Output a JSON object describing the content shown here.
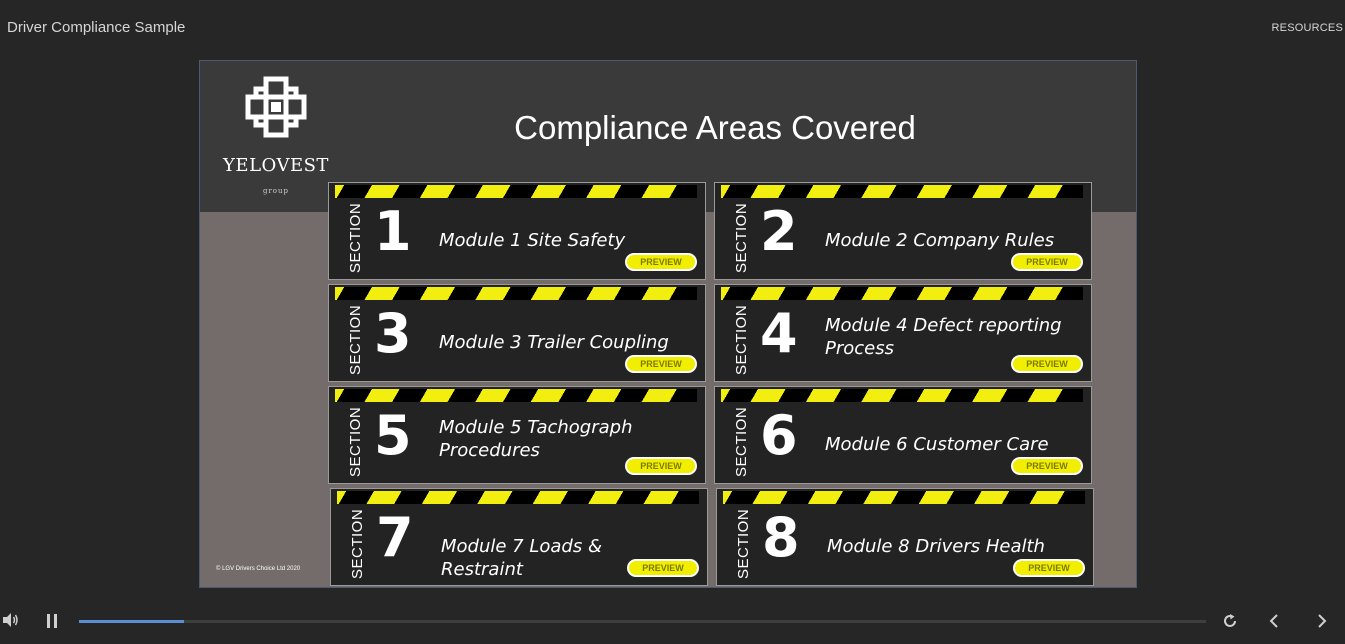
{
  "topbar": {
    "course_title": "Driver Compliance Sample",
    "resources_label": "RESOURCES"
  },
  "slide": {
    "logo_name": "YELOVEST",
    "logo_sub": "group",
    "title": "Compliance Areas Covered",
    "copyright": "© LGV Drivers Choice Ltd 2020",
    "section_label": "SECTION",
    "preview_label": "PREVIEW",
    "modules": [
      {
        "number": "1",
        "title": "Module 1 Site Safety"
      },
      {
        "number": "2",
        "title": "Module 2 Company Rules"
      },
      {
        "number": "3",
        "title": "Module 3 Trailer Coupling"
      },
      {
        "number": "4",
        "title": "Module 4 Defect reporting Process"
      },
      {
        "number": "5",
        "title": "Module 5 Tachograph Procedures"
      },
      {
        "number": "6",
        "title": "Module 6 Customer Care"
      },
      {
        "number": "7",
        "title": "Module 7 Loads & Restraint"
      },
      {
        "number": "8",
        "title": "Module 8 Drivers Health"
      }
    ]
  },
  "player": {
    "progress": 0.093,
    "icons": [
      "volume-icon",
      "pause-icon",
      "replay-icon",
      "prev-icon",
      "next-icon"
    ],
    "colors": {
      "progress": "#5b8fd1",
      "hazard_yellow": "#f2ee10",
      "preview_yellow": "#f2ee00"
    }
  }
}
